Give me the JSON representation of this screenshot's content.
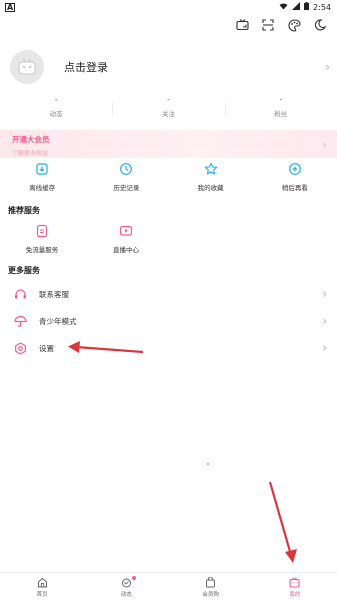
{
  "status_bar": {
    "left_glyph": "A",
    "time": "2:54"
  },
  "profile": {
    "login_label": "点击登录"
  },
  "stats": [
    {
      "num": "-",
      "label": "动态"
    },
    {
      "num": "-",
      "label": "关注"
    },
    {
      "num": "-",
      "label": "粉丝"
    }
  ],
  "vip": {
    "title": "开通大会员",
    "subtitle": "了解更多权益"
  },
  "quick": [
    {
      "label": "离线缓存",
      "icon": "download-icon"
    },
    {
      "label": "历史记录",
      "icon": "history-icon"
    },
    {
      "label": "我的收藏",
      "icon": "star-icon"
    },
    {
      "label": "稍后再看",
      "icon": "watch-later-icon"
    }
  ],
  "recommended": {
    "title": "推荐服务",
    "items": [
      {
        "label": "免流量服务",
        "icon": "free-data-icon"
      },
      {
        "label": "直播中心",
        "icon": "live-icon"
      }
    ]
  },
  "more": {
    "title": "更多服务",
    "items": [
      {
        "label": "联系客服",
        "icon": "headset-icon"
      },
      {
        "label": "青少年模式",
        "icon": "umbrella-icon"
      },
      {
        "label": "设置",
        "icon": "settings-icon"
      }
    ]
  },
  "nav": [
    {
      "label": "首页",
      "icon": "home-icon"
    },
    {
      "label": "动态",
      "icon": "dynamic-icon"
    },
    {
      "label": "会员购",
      "icon": "shop-icon"
    },
    {
      "label": "我的",
      "icon": "tv-icon"
    }
  ],
  "colors": {
    "accent": "#f25d8e",
    "arrow": "#d9363e"
  }
}
